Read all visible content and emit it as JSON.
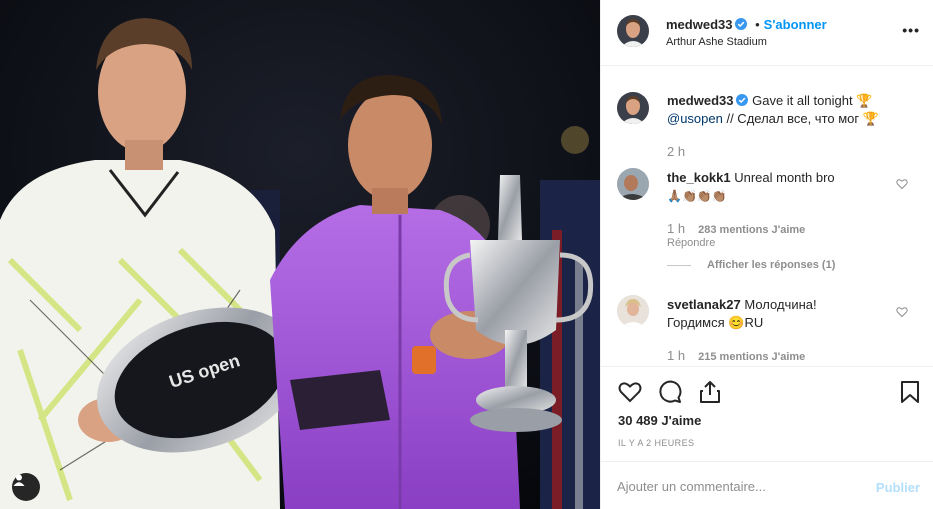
{
  "post": {
    "username": "medwed33",
    "separator": "•",
    "follow_label": "S'abonner",
    "location": "Arthur Ashe Stadium",
    "more_label": "•••",
    "caption_part1": "Gave it all tonight 🏆",
    "caption_mention": "@usopen",
    "caption_part2": " // Сделал все, что мог 🏆",
    "caption_time": "2 h"
  },
  "comments": [
    {
      "username": "the_kokk1",
      "text": "Unreal month bro",
      "emojis": "🙏🏽👏🏽👏🏽👏🏽",
      "time": "1 h",
      "likes": "283 mentions J'aime",
      "reply_label": "Répondre",
      "show_replies": "Afficher les réponses (1)"
    },
    {
      "username": "svetlanak27",
      "text": "Молодчина!",
      "text2": "Гордимся 😊RU",
      "time": "1 h",
      "likes": "215 mentions J'aime"
    }
  ],
  "actions": {
    "likes": "30 489 J'aime",
    "timestamp": "IL Y A 2 HEURES"
  },
  "comment_box": {
    "placeholder": "Ajouter un commentaire...",
    "publish_label": "Publier"
  },
  "colors": {
    "accent": "#0095f6",
    "muted": "#8e8e8e",
    "publish_disabled": "#b2dffc"
  }
}
